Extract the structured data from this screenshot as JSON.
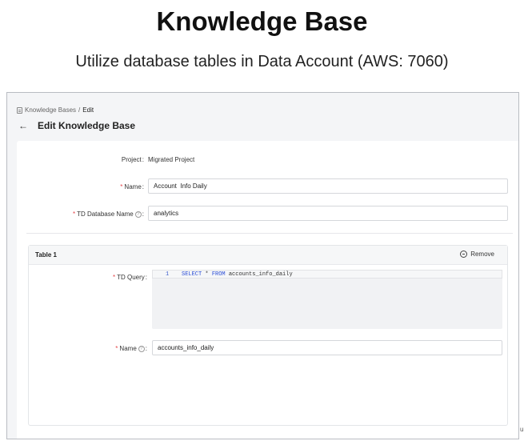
{
  "slide": {
    "title": "Knowledge Base",
    "subtitle": "Utilize database tables in Data Account (AWS: 7060)"
  },
  "breadcrumb": {
    "parent": "Knowledge Bases",
    "separator": "/",
    "current": "Edit"
  },
  "header": {
    "back_icon": "←",
    "title": "Edit Knowledge Base"
  },
  "form": {
    "project_label": "Project",
    "project_value": "Migrated Project",
    "required_mark": "*",
    "colon": ":",
    "name_label": "Name",
    "name_value": "Account  Info Daily",
    "db_label": "TD Database Name",
    "db_value": "analytics",
    "help_icon": "?"
  },
  "table1": {
    "title": "Table 1",
    "remove_label": "Remove",
    "query_label": "TD Query",
    "line_number": "1",
    "query_kw1": "SELECT",
    "query_mid": " * ",
    "query_kw2": "FROM",
    "query_rest": " accounts_info_daily",
    "name_label": "Name",
    "name_value": "accounts_info_daily"
  },
  "edge_char": "u",
  "colors": {
    "required": "#e5484d",
    "keyword": "#2b4ed6",
    "panel_bg": "#f4f5f7"
  },
  "icons": {
    "breadcrumb": "table-icon",
    "back": "arrow-left-icon",
    "remove": "minus-circle-icon",
    "help": "question-circle-icon"
  }
}
